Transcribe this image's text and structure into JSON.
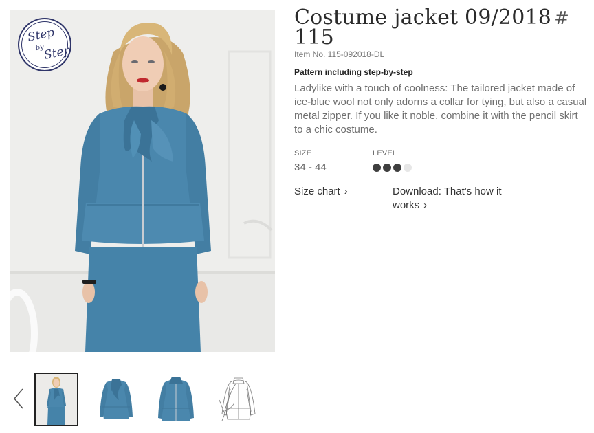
{
  "product": {
    "title": "Costume jacket 09/2018",
    "hash": "#",
    "number": "115",
    "item_no": "Item No. 115-092018-DL",
    "pattern_label": "Pattern including step-by-step",
    "description": "Ladylike with a touch of coolness: The tailored jacket made of ice-blue wool not only adorns a collar for tying, but also a casual metal zipper. If you like it noble, combine it with the pencil skirt to a chic costume."
  },
  "badge": {
    "line1": "Step",
    "line2": "by",
    "line3": "Step"
  },
  "specs": {
    "size_label": "SIZE",
    "size_value": "34 - 44",
    "level_label": "LEVEL",
    "level": 3,
    "level_max": 4
  },
  "links": {
    "size_chart": "Size chart",
    "download": "Download: That's how it works"
  },
  "thumbnails": [
    {
      "name": "model-photo",
      "active": true
    },
    {
      "name": "jacket-front-bow",
      "active": false
    },
    {
      "name": "jacket-front-open",
      "active": false
    },
    {
      "name": "technical-drawing",
      "active": false
    }
  ],
  "colors": {
    "jacket": "#4a87ad",
    "badge": "#2f3569"
  }
}
